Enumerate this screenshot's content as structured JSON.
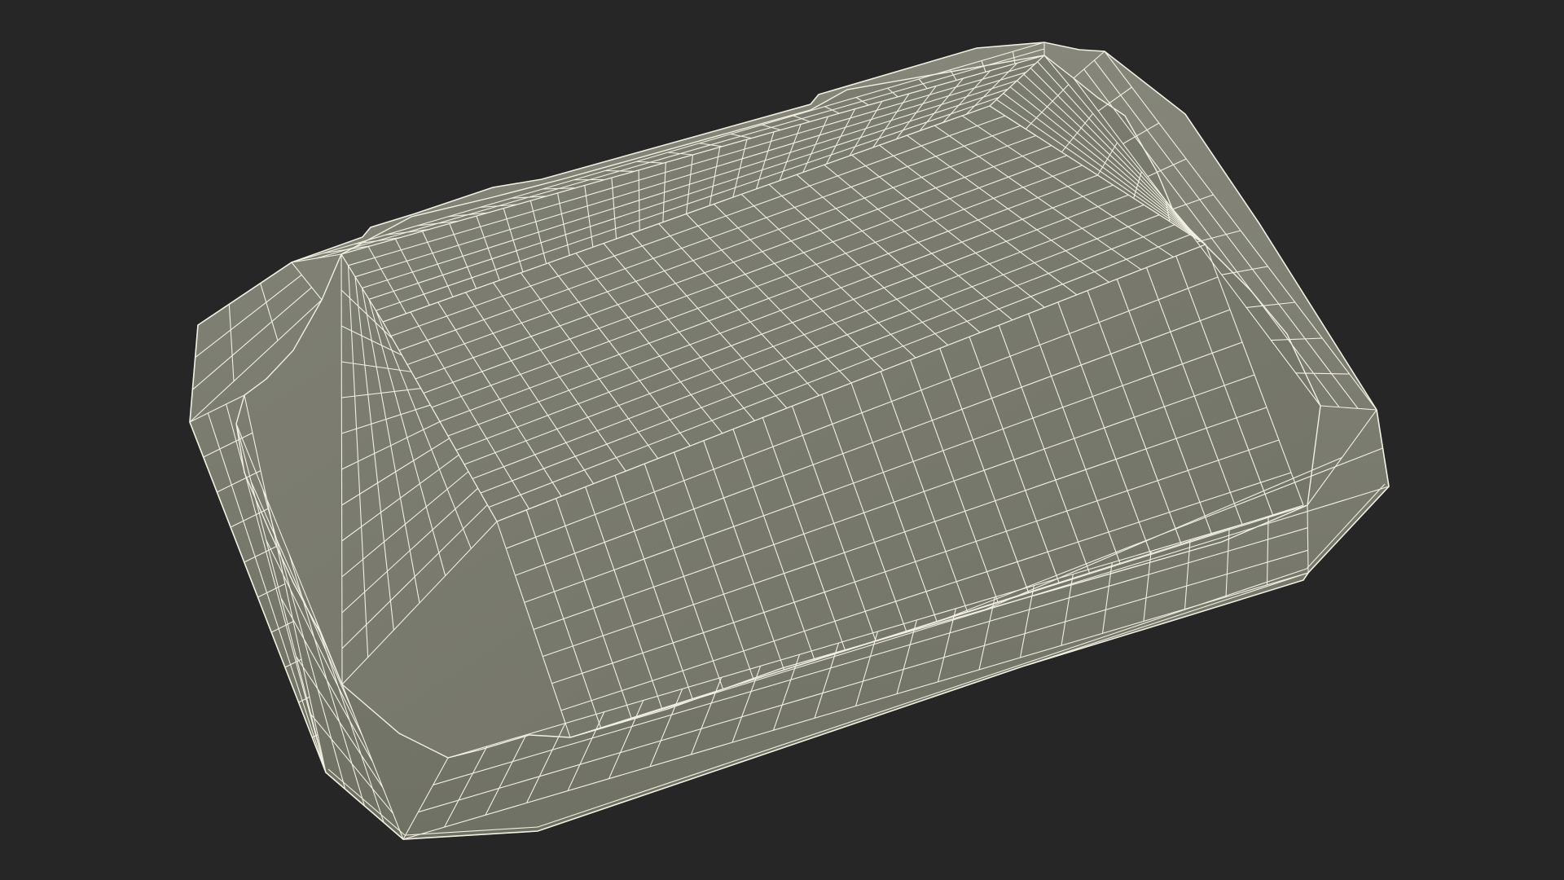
{
  "scene": {
    "background_color": "#262626",
    "mesh_fill_color": "#7b7c6f",
    "mesh_fill_dark": "#6f7064",
    "mesh_fill_light": "#86877a",
    "wire_color": "#f1f0e2",
    "object": "wireframe-tray-mesh"
  }
}
